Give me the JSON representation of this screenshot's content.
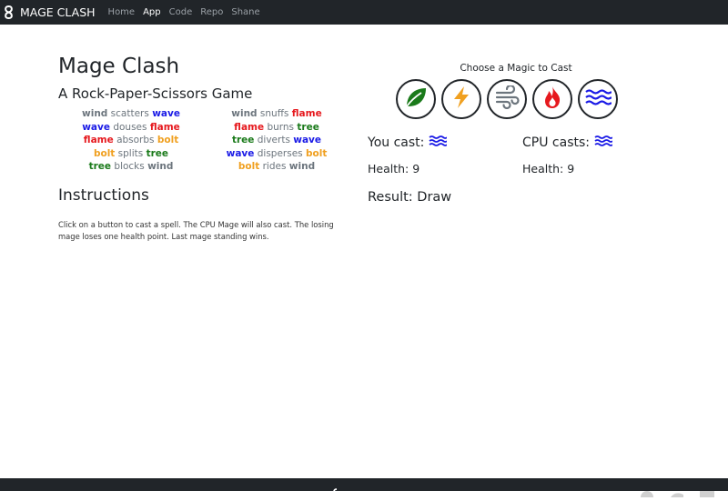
{
  "navbar": {
    "brand": "MAGE CLASH",
    "links": [
      "Home",
      "App",
      "Code",
      "Repo",
      "Shane"
    ],
    "active": "App"
  },
  "game": {
    "title": "Mage Clash",
    "subtitle": "A Rock-Paper-Scissors Game",
    "rules_left": [
      {
        "a": "wind",
        "verb": "scatters",
        "b": "wave"
      },
      {
        "a": "wave",
        "verb": "douses",
        "b": "flame"
      },
      {
        "a": "flame",
        "verb": "absorbs",
        "b": "bolt"
      },
      {
        "a": "bolt",
        "verb": "splits",
        "b": "tree"
      },
      {
        "a": "tree",
        "verb": "blocks",
        "b": "wind"
      }
    ],
    "rules_right": [
      {
        "a": "wind",
        "verb": "snuffs",
        "b": "flame"
      },
      {
        "a": "flame",
        "verb": "burns",
        "b": "tree"
      },
      {
        "a": "tree",
        "verb": "diverts",
        "b": "wave"
      },
      {
        "a": "wave",
        "verb": "disperses",
        "b": "bolt"
      },
      {
        "a": "bolt",
        "verb": "rides",
        "b": "wind"
      }
    ],
    "instructions_heading": "Instructions",
    "instructions_text": "Click on a button to cast a spell. The CPU Mage will also cast. The losing mage loses one health point. Last mage standing wins."
  },
  "panel": {
    "choose_label": "Choose a Magic to Cast",
    "spells": [
      {
        "name": "tree",
        "icon": "leaf-icon",
        "color": "#1a7a1a"
      },
      {
        "name": "bolt",
        "icon": "bolt-icon",
        "color": "#f0a020"
      },
      {
        "name": "wind",
        "icon": "wind-icon",
        "color": "#6c757d"
      },
      {
        "name": "flame",
        "icon": "flame-icon",
        "color": "#e6191e"
      },
      {
        "name": "wave",
        "icon": "wave-icon",
        "color": "#1a1ae6"
      }
    ],
    "you_cast_label": "You cast:",
    "you_cast_spell": "wave",
    "cpu_cast_label": "CPU casts:",
    "cpu_cast_spell": "wave",
    "you_health": "Health: 9",
    "cpu_health": "Health: 9",
    "result": "Result: Draw"
  },
  "colors": {
    "navbar": "#212529",
    "wind": "#6c757d",
    "wave": "#1a1ae6",
    "flame": "#e6191e",
    "bolt": "#f0a020",
    "tree": "#1a7a1a"
  }
}
